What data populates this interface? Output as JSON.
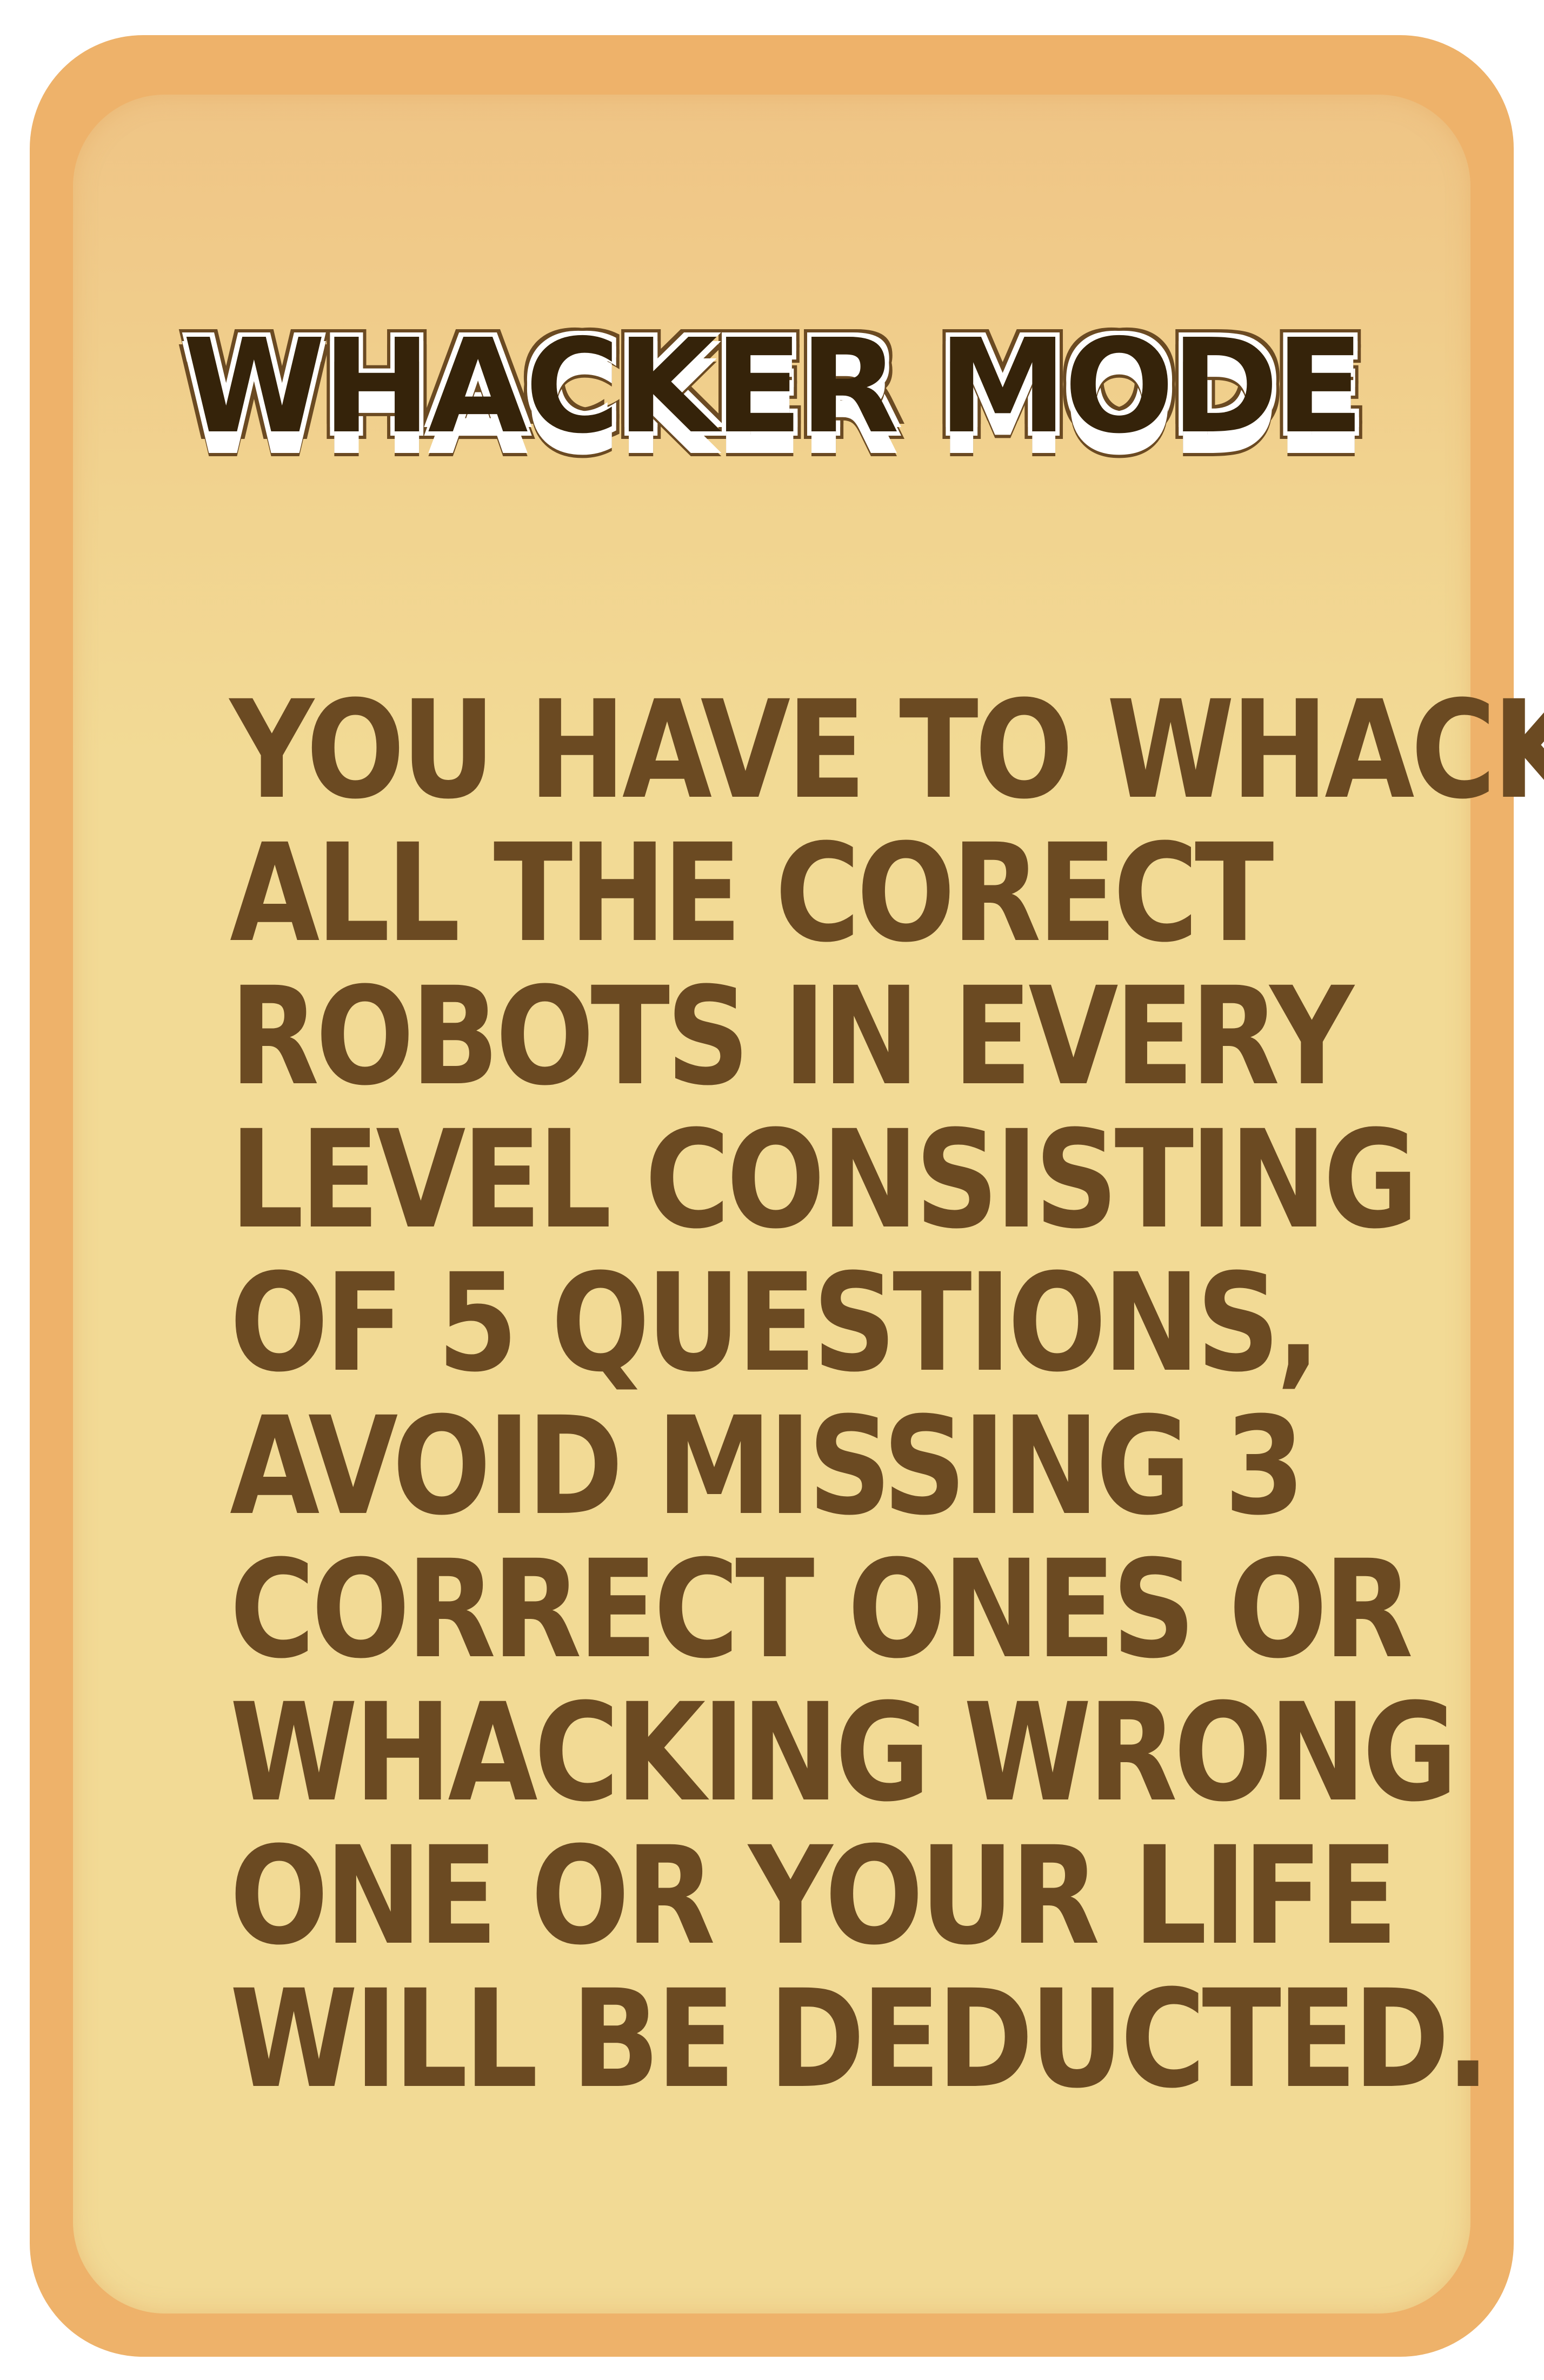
{
  "title": "WHACKER MODE",
  "body_lines": [
    "YOU HAVE TO WHACK",
    "ALL THE CORECT",
    "ROBOTS IN EVERY",
    "LEVEL CONSISTING",
    "OF 5 QUESTIONS,",
    "AVOID MISSING 3",
    "CORRECT ONES OR",
    "WHACKING WRONG",
    "ONE OR YOUR LIFE",
    "WILL BE DEDUCTED."
  ],
  "colors": {
    "frame": "#EEB26A",
    "panel": "#F2DA95",
    "text": "#6B4A22",
    "title": "#35230A"
  }
}
